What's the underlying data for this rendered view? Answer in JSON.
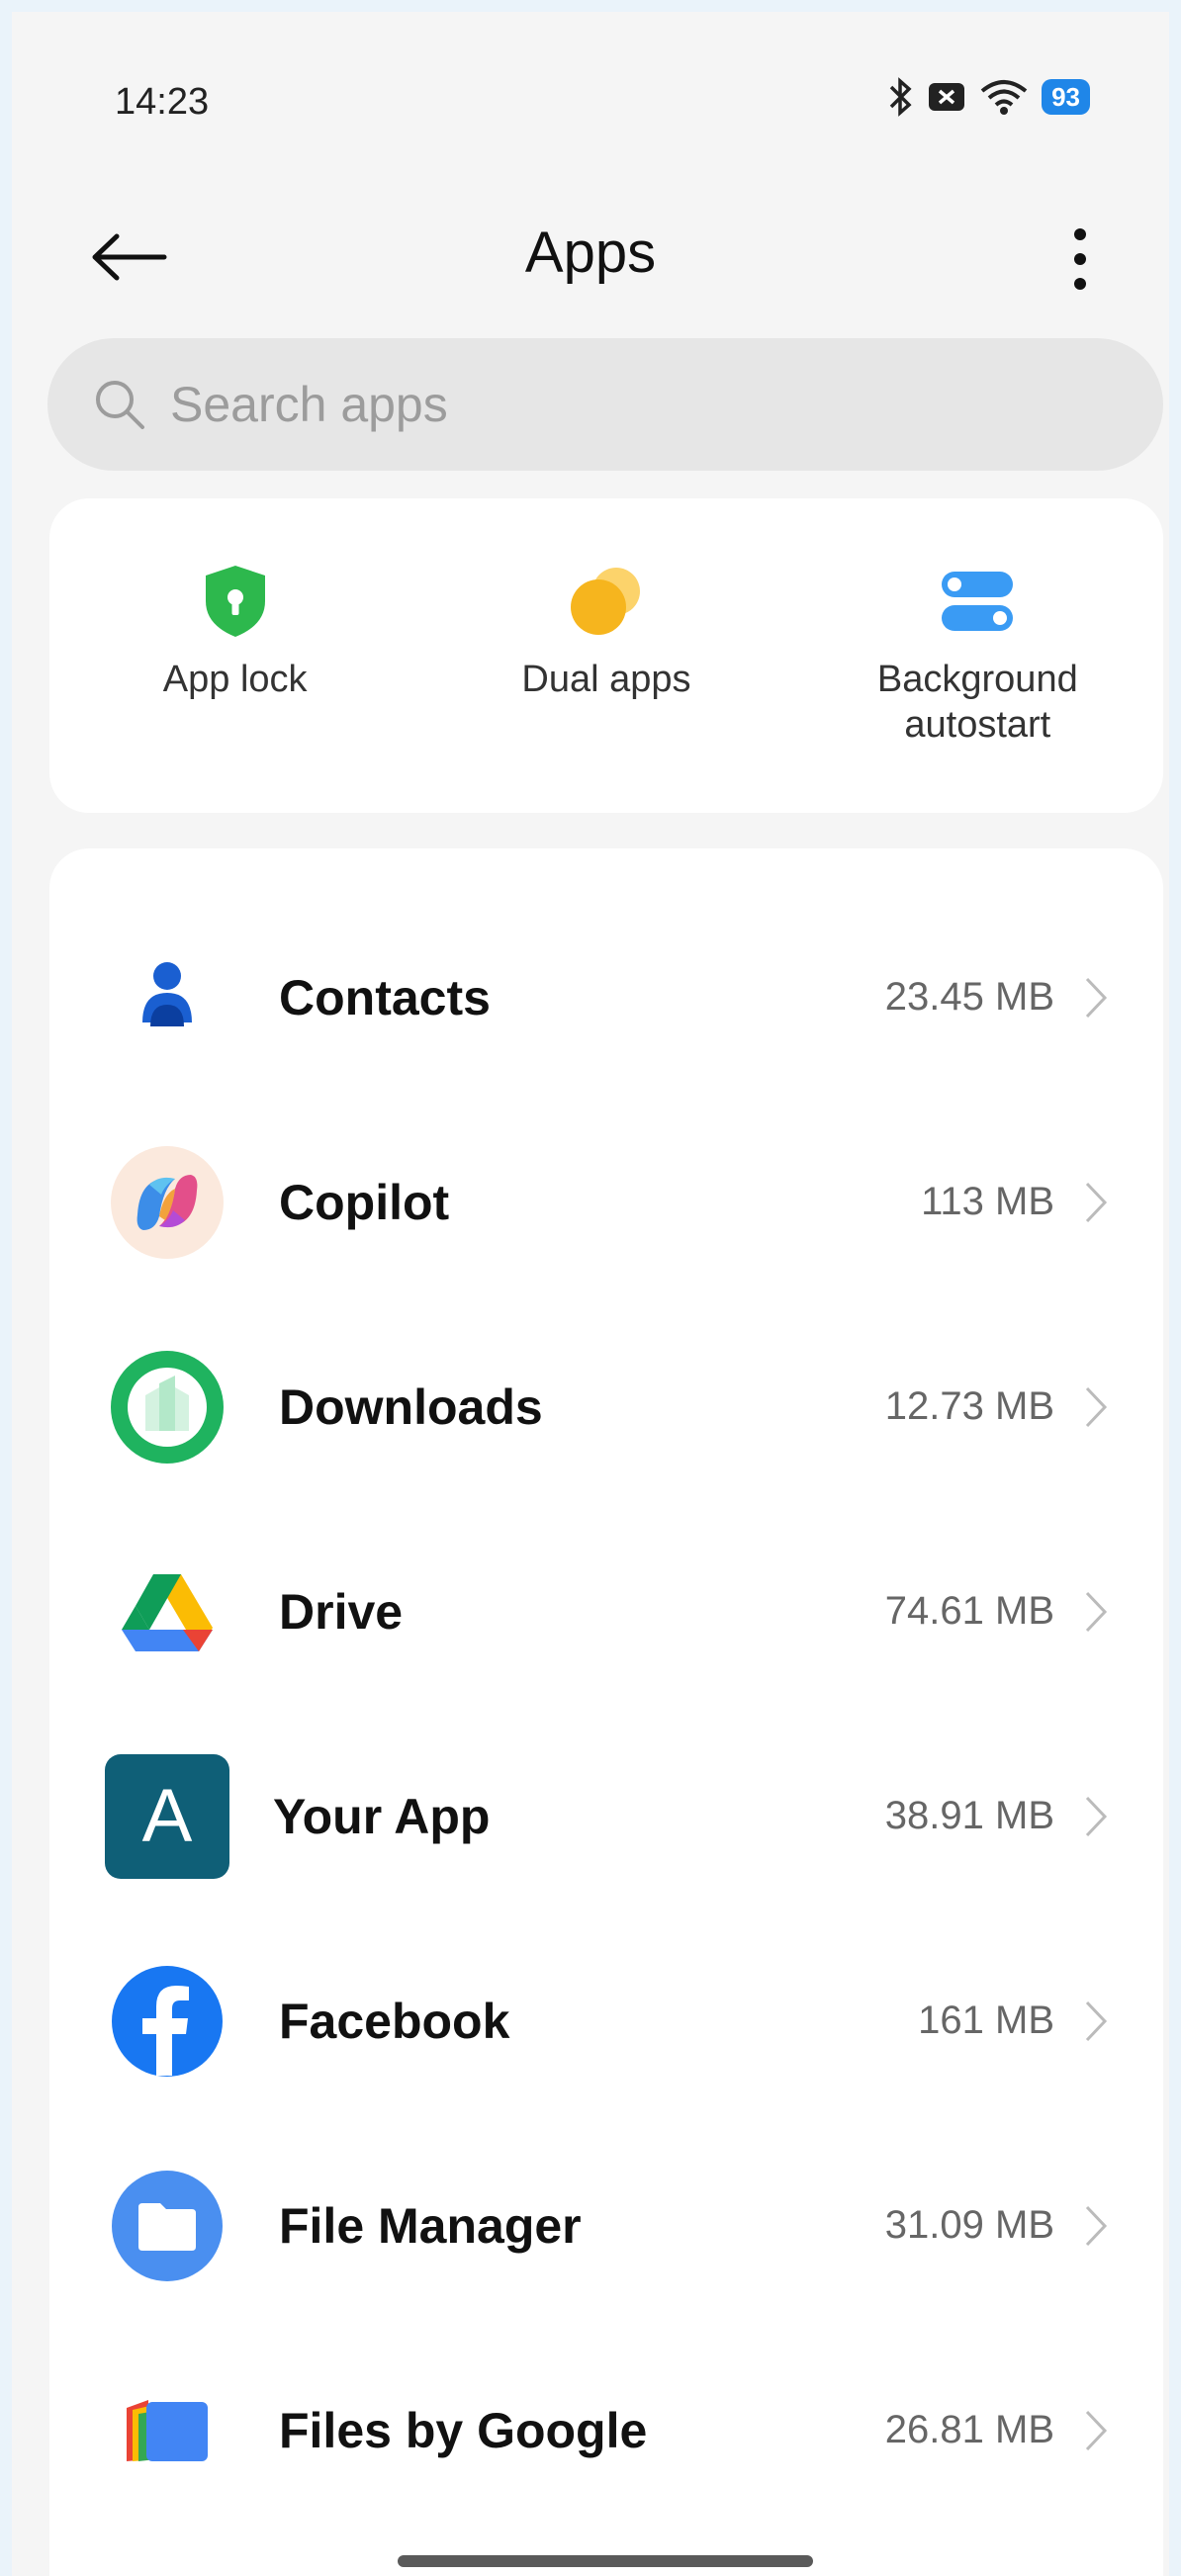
{
  "status": {
    "time": "14:23",
    "battery": "93"
  },
  "header": {
    "title": "Apps"
  },
  "search": {
    "placeholder": "Search apps"
  },
  "quick_actions": [
    {
      "label": "App lock",
      "icon": "shield-lock-icon",
      "color": "#2db84d"
    },
    {
      "label": "Dual apps",
      "icon": "dual-circles-icon",
      "color": "#f6b51e"
    },
    {
      "label": "Background autostart",
      "icon": "toggle-switches-icon",
      "color": "#3a9bf4"
    }
  ],
  "apps": [
    {
      "name": "Contacts",
      "size": "23.45 MB",
      "icon": "contacts-icon"
    },
    {
      "name": "Copilot",
      "size": "113 MB",
      "icon": "copilot-icon"
    },
    {
      "name": "Downloads",
      "size": "12.73 MB",
      "icon": "downloads-icon"
    },
    {
      "name": "Drive",
      "size": "74.61 MB",
      "icon": "drive-icon"
    },
    {
      "name": "Your App",
      "size": "38.91 MB",
      "icon": "your-app-icon",
      "icon_letter": "A"
    },
    {
      "name": "Facebook",
      "size": "161 MB",
      "icon": "facebook-icon"
    },
    {
      "name": "File Manager",
      "size": "31.09 MB",
      "icon": "file-manager-icon"
    },
    {
      "name": "Files by Google",
      "size": "26.81 MB",
      "icon": "files-by-google-icon"
    }
  ],
  "colors": {
    "accent_blue": "#1f86e8",
    "background": "#f5f5f5",
    "card": "#ffffff"
  }
}
